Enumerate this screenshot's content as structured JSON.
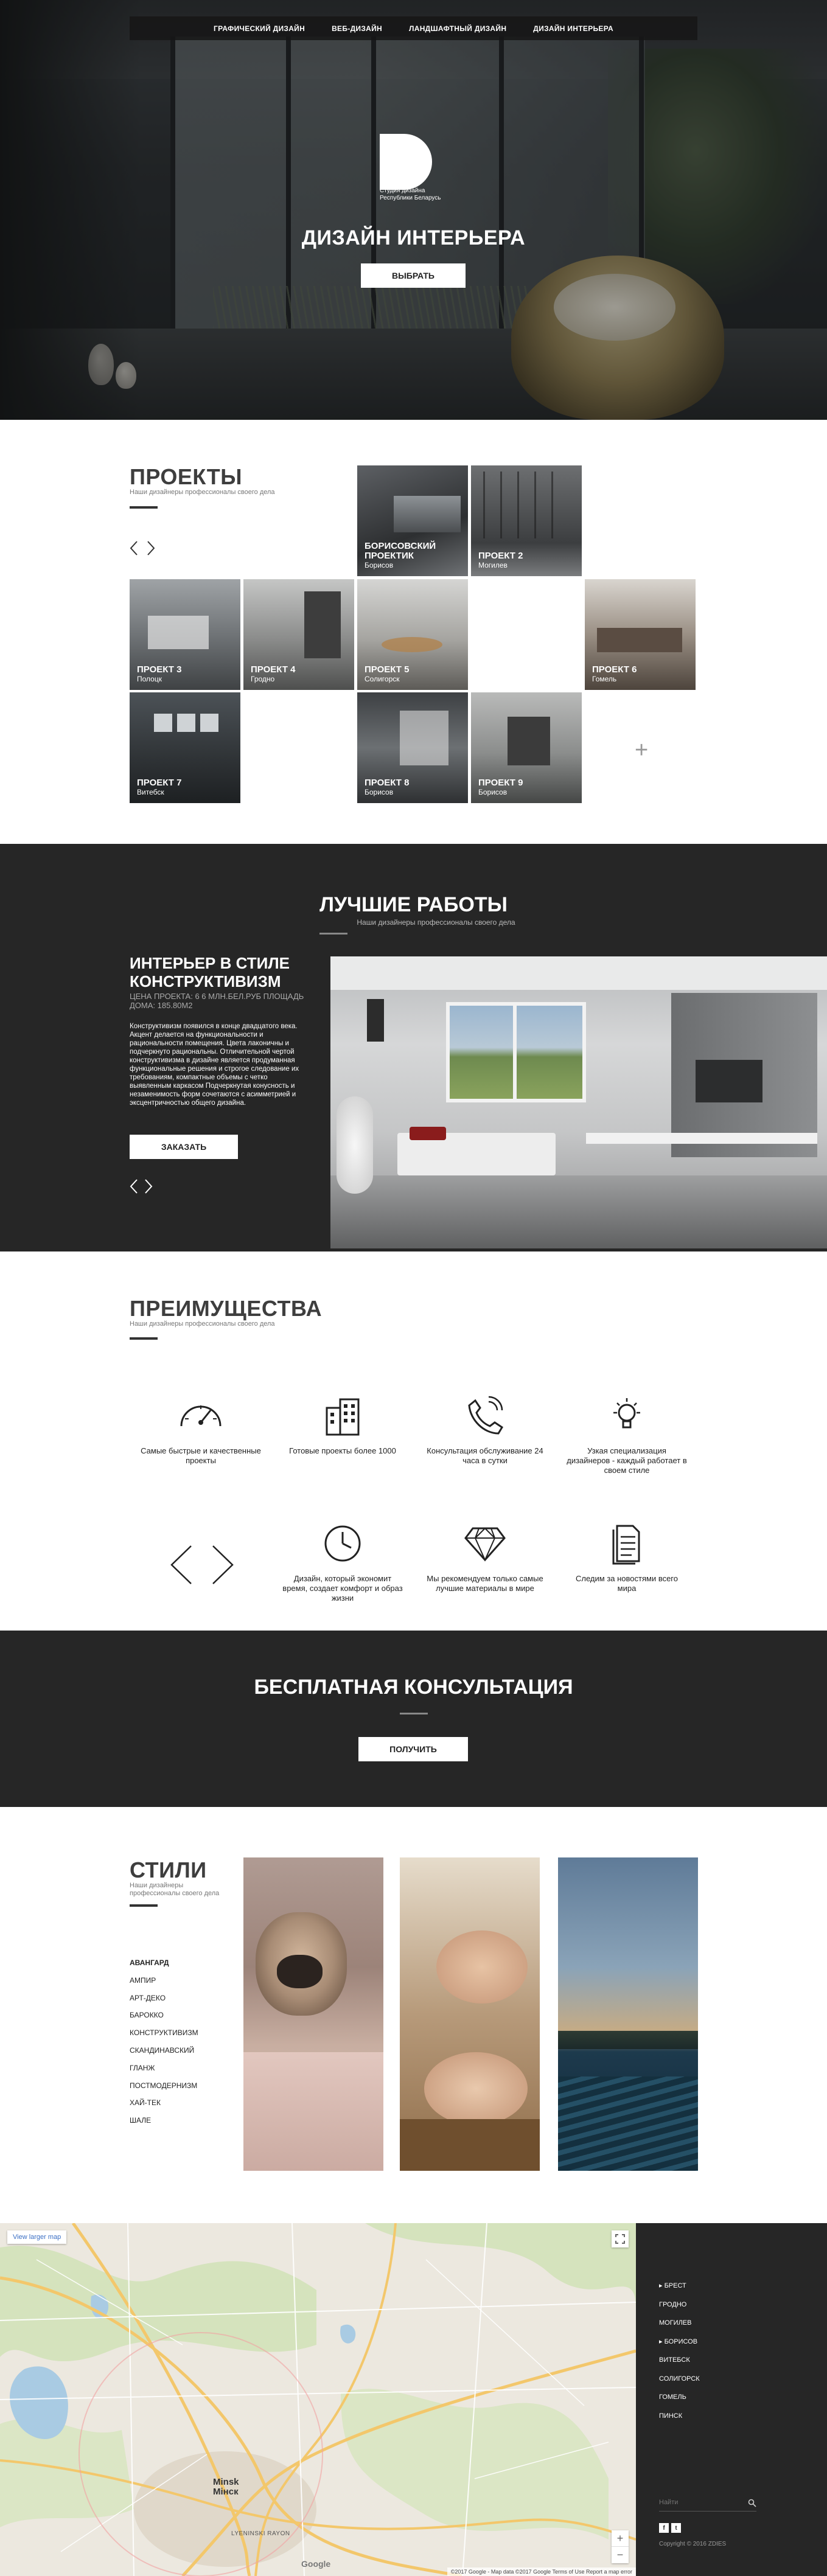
{
  "nav": [
    "ГРАФИЧЕСКИЙ ДИЗАЙН",
    "ВЕБ-ДИЗАЙН",
    "ЛАНДШАФТНЫЙ ДИЗАЙН",
    "ДИЗАЙН ИНТЕРЬЕРА"
  ],
  "hero": {
    "logo_letter": "D",
    "logo_sub_1": "Студия дизайна",
    "logo_sub_2": "Республики Беларусь",
    "title": "ДИЗАЙН ИНТЕРЬЕРА",
    "button": "ВЫБРАТЬ"
  },
  "projects": {
    "title": "ПРОЕКТЫ",
    "subtitle": "Наши дизайнеры профессионалы своего дела",
    "items": [
      {
        "name": "БОРИСОВСКИЙ ПРОЕКТИК",
        "city": "Борисов"
      },
      {
        "name": "ПРОЕКТ 2",
        "city": "Могилев"
      },
      {
        "name": "ПРОЕКТ 3",
        "city": "Полоцк"
      },
      {
        "name": "ПРОЕКТ 4",
        "city": "Гродно"
      },
      {
        "name": "ПРОЕКТ 5",
        "city": "Солигорск"
      },
      {
        "name": "ПРОЕКТ 6",
        "city": "Гомель"
      },
      {
        "name": "ПРОЕКТ 7",
        "city": "Витебск"
      },
      {
        "name": "ПРОЕКТ 8",
        "city": "Борисов"
      },
      {
        "name": "ПРОЕКТ 9",
        "city": "Борисов"
      }
    ],
    "plus": "+"
  },
  "best": {
    "title": "ЛУЧШИЕ РАБОТЫ",
    "subtitle": "Наши дизайнеры профессионалы своего дела",
    "heading": "ИНТЕРЬЕР В СТИЛЕ КОНСТРУКТИВИЗМ",
    "meta": "ЦЕНА ПРОЕКТА: 6 6 МЛН.БЕЛ.РУБ ПЛОЩАДЬ ДОМА: 185.80М2",
    "text": "Конструктивизм появился в конце двадцатого века. Акцент делается на функциональности и рациональности помещения. Цвета лаконичны и подчеркнуто рациональны. Отличительной чертой конструктивизма в дизайне является продуманная функциональные решения и строгое следование их требованиям, компактные объемы с четко выявленным каркасом Подчеркнутая конусность и незаменимость форм сочетаются с асимметрией и эксцентричностью общего дизайна.",
    "button": "ЗАКАЗАТЬ"
  },
  "advantages": {
    "title": "ПРЕИМУЩЕСТВА",
    "subtitle": "Наши дизайнеры профессионалы своего дела",
    "items": [
      {
        "icon": "speedometer-icon",
        "text": "Самые быстрые и качественные проекты"
      },
      {
        "icon": "buildings-icon",
        "text": "Готовые проекты более 1000"
      },
      {
        "icon": "phone-icon",
        "text": "Консультация обслуживание 24 часа в сутки"
      },
      {
        "icon": "lightbulb-icon",
        "text": "Узкая специализация дизайнеров - каждый работает в своем стиле"
      },
      {
        "icon": "clock-icon",
        "text": "Дизайн, который экономит время, создает комфорт и образ жизни"
      },
      {
        "icon": "diamond-icon",
        "text": "Мы рекомендуем только самые лучшие материалы в мире"
      },
      {
        "icon": "document-icon",
        "text": "Следим за новостями всего мира"
      }
    ]
  },
  "consult": {
    "title": "БЕСПЛАТНАЯ КОНСУЛЬТАЦИЯ",
    "button": "ПОЛУЧИТЬ"
  },
  "styles": {
    "title": "СТИЛИ",
    "subtitle": "Наши дизайнеры профессионалы своего дела",
    "list": [
      "АВАНГАРД",
      "АМПИР",
      "АРТ-ДЕКО",
      "БАРОККО",
      "КОНСТРУКТИВИЗМ",
      "СКАНДИНАВСКИЙ",
      "ГЛАНЖ",
      "ПОСТМОДЕРНИЗМ",
      "ХАЙ-ТЕК",
      "ШАЛЕ"
    ]
  },
  "map": {
    "larger_link": "View larger map",
    "city_label_1": "Minsk",
    "city_label_2": "Мінск",
    "district": "LYENINSKI RAYON",
    "footer": "©2017 Google - Map data ©2017 Google   Terms of Use   Report a map error",
    "google": "Google",
    "zoom_in": "+",
    "zoom_out": "−"
  },
  "footer": {
    "cities": [
      "БРЕСТ",
      "ГРОДНО",
      "МОГИЛЕВ",
      "БОРИСОВ",
      "ВИТЕБСК",
      "СОЛИГОРСК",
      "ГОМЕЛЬ",
      "ПИНСК"
    ],
    "active_city_index": 3,
    "search_placeholder": "Найти",
    "social_1": "f",
    "social_2": "t",
    "copyright": "Copyright © 2016 ZDIES"
  }
}
